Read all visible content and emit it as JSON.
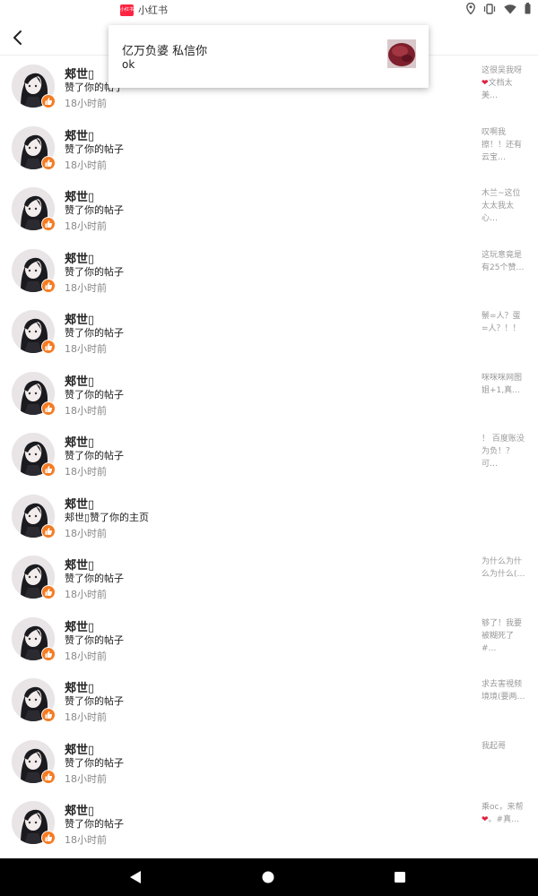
{
  "status_bar": {
    "app_badge": "小红书",
    "app_name": "小红书",
    "icons": [
      "location-icon",
      "vibrate-icon",
      "wifi-icon",
      "battery-icon"
    ]
  },
  "header": {
    "back_icon": "chevron-left-icon"
  },
  "notification": {
    "title": "亿万负婆 私信你",
    "body": "ok"
  },
  "colors": {
    "like_badge": "#f57c23",
    "brand": "#ff2442",
    "nav_bar": "#000000"
  },
  "rows": [
    {
      "name": "郏世▯",
      "action": "赞了你的帖子",
      "time": "18小时前",
      "preview": "这很吴我呀",
      "preview_heart": true,
      "preview_after": "文档太美…"
    },
    {
      "name": "郏世▯",
      "action": "赞了你的帖子",
      "time": "18小时前",
      "preview": "叹啊我擦！！还有云宝…",
      "preview_heart": false,
      "preview_after": ""
    },
    {
      "name": "郏世▯",
      "action": "赞了你的帖子",
      "time": "18小时前",
      "preview": "木兰~这位太太我太心…",
      "preview_heart": false,
      "preview_after": ""
    },
    {
      "name": "郏世▯",
      "action": "赞了你的帖子",
      "time": "18小时前",
      "preview": "这玩意竟是有25个赞…",
      "preview_heart": false,
      "preview_after": ""
    },
    {
      "name": "郏世▯",
      "action": "赞了你的帖子",
      "time": "18小时前",
      "preview": "鬃=人？蛋=人？！！",
      "preview_heart": false,
      "preview_after": ""
    },
    {
      "name": "郏世▯",
      "action": "赞了你的帖子",
      "time": "18小时前",
      "preview": "咪咪咪网图姐+1,真…",
      "preview_heart": false,
      "preview_after": ""
    },
    {
      "name": "郏世▯",
      "action": "赞了你的帖子",
      "time": "18小时前",
      "preview": "！ 百度账没为负！？可…",
      "preview_heart": false,
      "preview_after": ""
    },
    {
      "name": "郏世▯",
      "action": "郏世▯赞了你的主页",
      "time": "18小时前",
      "preview": "",
      "preview_heart": false,
      "preview_after": ""
    },
    {
      "name": "郏世▯",
      "action": "赞了你的帖子",
      "time": "18小时前",
      "preview": "为什么为什么为什么(…",
      "preview_heart": false,
      "preview_after": ""
    },
    {
      "name": "郏世▯",
      "action": "赞了你的帖子",
      "time": "18小时前",
      "preview": "够了！我要被糊死了#…",
      "preview_heart": false,
      "preview_after": ""
    },
    {
      "name": "郏世▯",
      "action": "赞了你的帖子",
      "time": "18小时前",
      "preview": "求去害視频境境(要两…",
      "preview_heart": false,
      "preview_after": ""
    },
    {
      "name": "郏世▯",
      "action": "赞了你的帖子",
      "time": "18小时前",
      "preview": "我起哥",
      "preview_heart": false,
      "preview_after": ""
    },
    {
      "name": "郏世▯",
      "action": "赞了你的帖子",
      "time": "18小时前",
      "preview": "乘oc，来帮",
      "preview_heart": true,
      "preview_after": "。#真…"
    }
  ],
  "nav_bar": {
    "back_icon": "triangle-back-icon",
    "home_icon": "circle-home-icon",
    "recents_icon": "square-recents-icon"
  }
}
